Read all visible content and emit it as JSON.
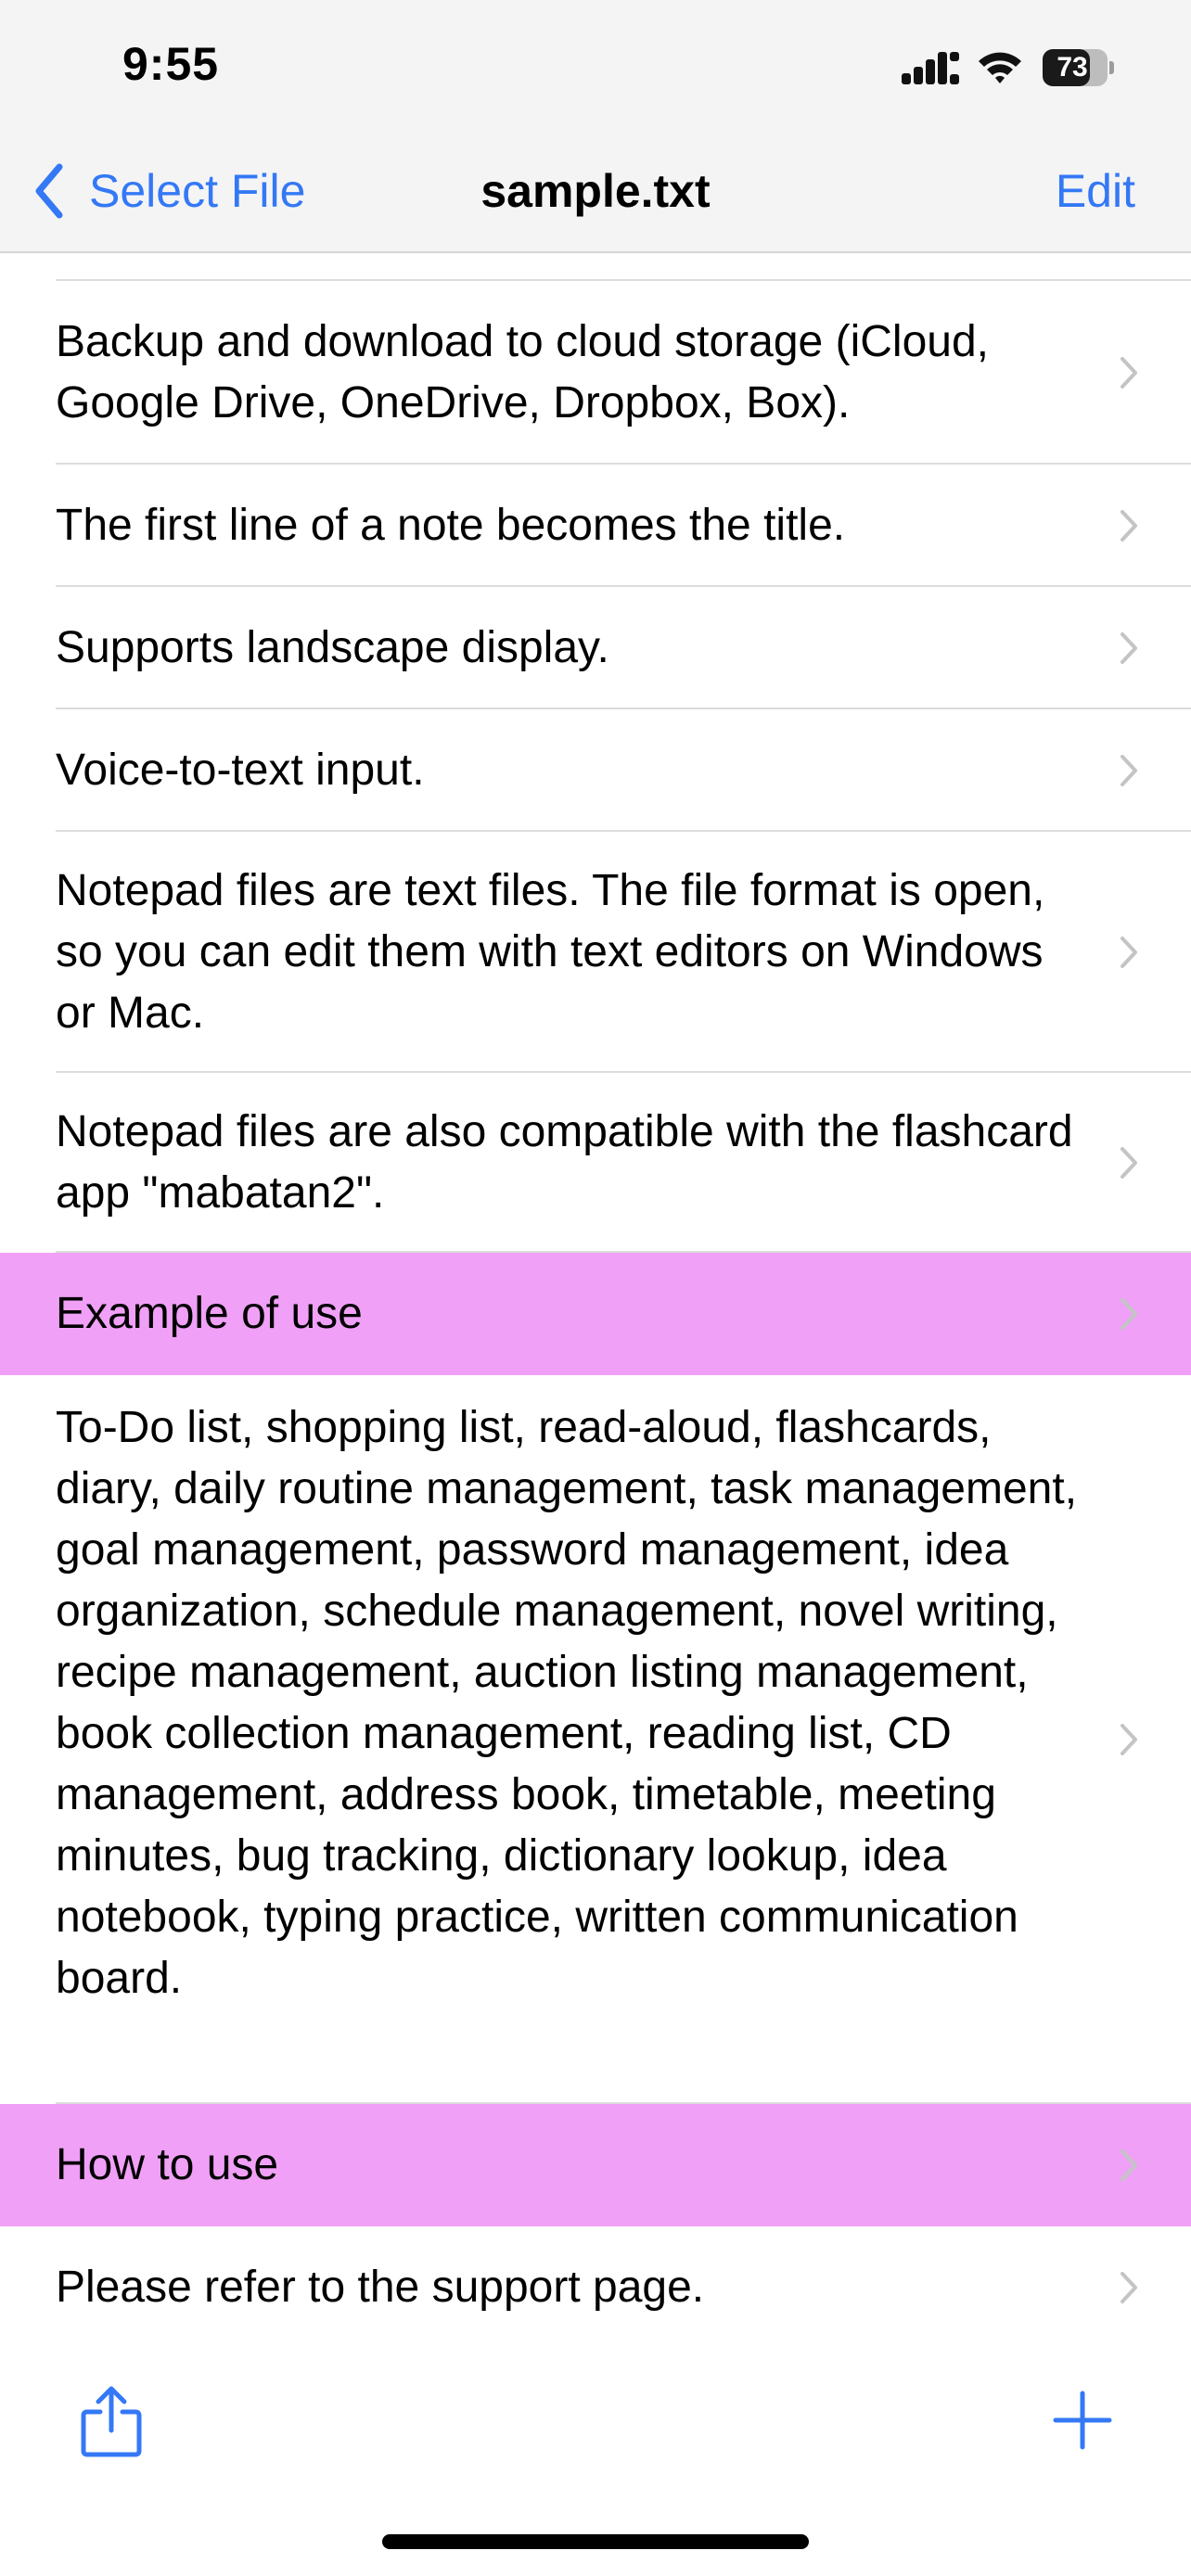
{
  "status_bar": {
    "time": "9:55",
    "battery_level": "73",
    "icons": [
      "cellular-signal-icon",
      "wifi-icon",
      "battery-icon"
    ]
  },
  "nav": {
    "back_label": "Select File",
    "title": "sample.txt",
    "edit_label": "Edit"
  },
  "rows": [
    {
      "text": "Backup and download to cloud storage (iCloud, Google Drive, OneDrive, Dropbox, Box).",
      "header": false
    },
    {
      "text": "The first line of a note becomes the title.",
      "header": false
    },
    {
      "text": "Supports landscape display.",
      "header": false
    },
    {
      "text": "Voice-to-text input.",
      "header": false
    },
    {
      "text": "Notepad files are text files. The file format is open, so you can edit them with text editors on Windows or Mac.",
      "header": false
    },
    {
      "text": "Notepad files are also compatible with the flashcard app \"mabatan2\".",
      "header": false
    },
    {
      "text": "Example of use",
      "header": true
    },
    {
      "text": "To-Do list, shopping list, read-aloud, flashcards, diary, daily routine management, task management, goal management, password management, idea organization, schedule management, novel writing, recipe management, auction listing management, book collection management, reading list, CD management, address book, timetable, meeting minutes, bug tracking, dictionary lookup, idea notebook, typing practice, written communication board.",
      "header": false
    },
    {
      "text": "How to use",
      "header": true
    },
    {
      "text": "Please refer to the support page.",
      "header": false
    }
  ],
  "toolbar": {
    "share_icon": "share-icon",
    "add_icon": "plus-icon"
  },
  "colors": {
    "accent": "#3478f6",
    "header_highlight": "#f0a0f6",
    "chevron": "#c4c4c6",
    "separator": "#dcdcdc"
  }
}
